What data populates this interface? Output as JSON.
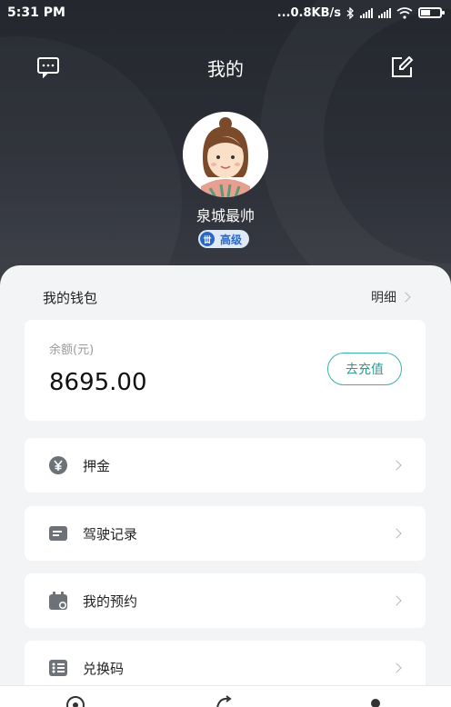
{
  "status_bar": {
    "time": "5:31 PM",
    "network_speed": "...0.8KB/s",
    "icons": [
      "bluetooth-icon",
      "signal-icon",
      "signal-icon",
      "wifi-icon",
      "battery-icon"
    ]
  },
  "header": {
    "title": "我的",
    "left_icon": "message-icon",
    "right_icon": "edit-icon"
  },
  "profile": {
    "nickname": "泉城最帅",
    "level_icon_text": "丗",
    "level_label": "高级"
  },
  "wallet": {
    "title": "我的钱包",
    "detail_label": "明细",
    "balance_label": "余额(元)",
    "balance_value": "8695.00",
    "recharge_label": "去充值"
  },
  "menu": [
    {
      "label": "押金",
      "icon": "yen-coin-icon"
    },
    {
      "label": "驾驶记录",
      "icon": "record-card-icon"
    },
    {
      "label": "我的预约",
      "icon": "calendar-icon"
    },
    {
      "label": "兑换码",
      "icon": "voucher-icon"
    }
  ],
  "tabbar": {
    "icons": [
      "home-tab-icon",
      "discover-tab-icon",
      "profile-tab-icon"
    ]
  },
  "colors": {
    "header_bg": "#24272e",
    "accent": "#2a9d95",
    "badge": "#2a68c8"
  }
}
